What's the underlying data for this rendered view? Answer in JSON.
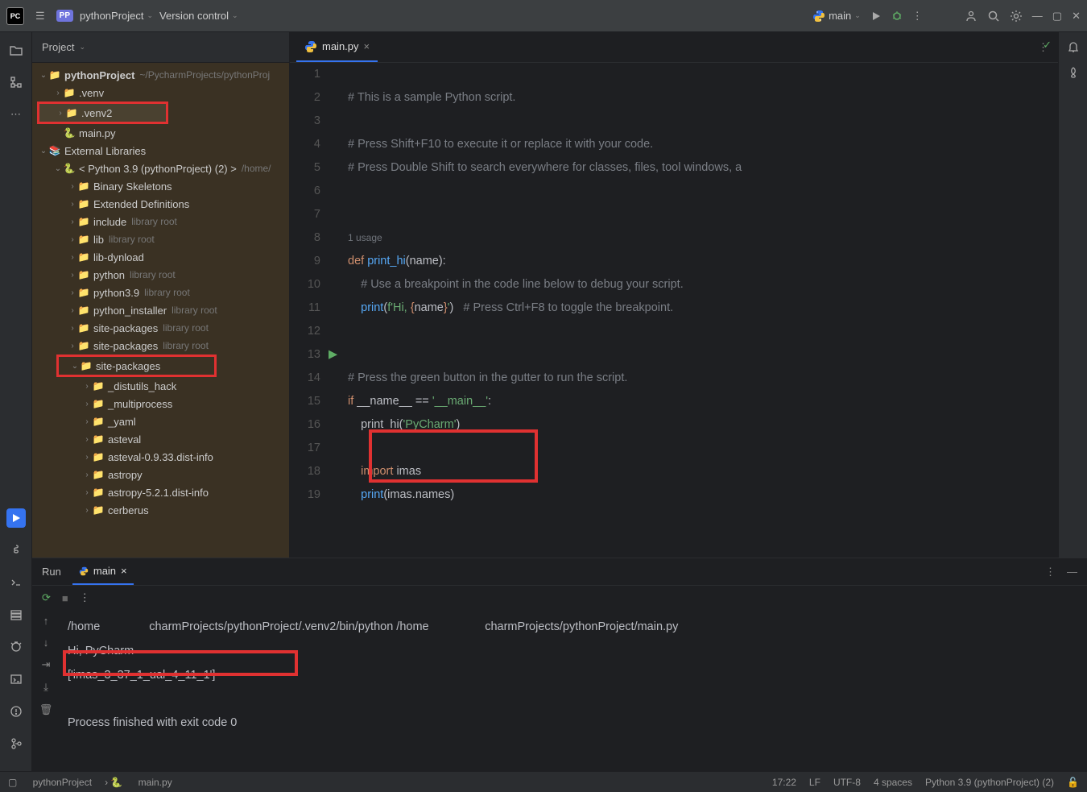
{
  "top": {
    "logo": "PC",
    "badge": "PP",
    "projectName": "pythonProject",
    "vcs": "Version control",
    "runConfig": "main"
  },
  "projectHeader": "Project",
  "tree": {
    "root": {
      "name": "pythonProject",
      "path": "~/PycharmProjects/pythonProj"
    },
    "venv": ".venv",
    "venv2": ".venv2",
    "mainpy": "main.py",
    "extlib": "External Libraries",
    "python39": "< Python 3.9 (pythonProject) (2) >",
    "python39path": "/home/",
    "items": [
      {
        "n": "Binary Skeletons",
        "d": ""
      },
      {
        "n": "Extended Definitions",
        "d": ""
      },
      {
        "n": "include",
        "d": "library root"
      },
      {
        "n": "lib",
        "d": "library root"
      },
      {
        "n": "lib-dynload",
        "d": ""
      },
      {
        "n": "python",
        "d": "library root"
      },
      {
        "n": "python3.9",
        "d": "library root"
      },
      {
        "n": "python_installer",
        "d": "library root"
      },
      {
        "n": "site-packages",
        "d": "library root"
      },
      {
        "n": "site-packages",
        "d": "library root"
      }
    ],
    "sitepkg": "site-packages",
    "pkgs": [
      "_distutils_hack",
      "_multiprocess",
      "_yaml",
      "asteval",
      "asteval-0.9.33.dist-info",
      "astropy",
      "astropy-5.2.1.dist-info",
      "cerberus"
    ]
  },
  "editor": {
    "tab": "main.py",
    "lines": {
      "l1": "# This is a sample Python script.",
      "l3": "# Press Shift+F10 to execute it or replace it with your code.",
      "l4": "# Press Double Shift to search everywhere for classes, files, tool windows, a",
      "usage": "1 usage",
      "l7a": "def ",
      "l7b": "print_hi",
      "l7c": "(name):",
      "l8": "    # Use a breakpoint in the code line below to debug your script.",
      "l9a": "    ",
      "l9b": "print",
      "l9c": "(",
      "l9d": "f'Hi, ",
      "l9e": "{",
      "l9f": "name",
      "l9g": "}",
      "l9h": "'",
      "l9i": ")   ",
      "l9j": "# Press Ctrl+F8 to toggle the breakpoint.",
      "l12": "# Press the green button in the gutter to run the script.",
      "l13a": "if ",
      "l13b": "__name__ == ",
      "l13c": "'__main__'",
      "l13d": ":",
      "l14": "    print_hi(",
      "l14b": "'PyCharm'",
      "l14c": ")",
      "l16a": "    ",
      "l16b": "import ",
      "l16c": "imas",
      "l17a": "    ",
      "l17b": "print",
      "l17c": "(imas.names)"
    },
    "lineNums": [
      "1",
      "2",
      "3",
      "4",
      "5",
      "6",
      "",
      "7",
      "8",
      "9",
      "10",
      "11",
      "12",
      "13",
      "14",
      "15",
      "16",
      "17",
      "18",
      "19"
    ]
  },
  "run": {
    "label": "Run",
    "tab": "main",
    "out1a": "/home",
    "out1b": "charmProjects/pythonProject/.venv2/bin/python /home",
    "out1c": "charmProjects/pythonProject/main.py",
    "out2": "Hi, PyCharm",
    "out3": "['imas_3_37_1_ual_4_11_1']",
    "out4": "Process finished with exit code 0"
  },
  "status": {
    "crumb1": "pythonProject",
    "crumb2": "main.py",
    "time": "17:22",
    "enc1": "LF",
    "enc2": "UTF-8",
    "indent": "4 spaces",
    "interp": "Python 3.9 (pythonProject) (2)"
  }
}
